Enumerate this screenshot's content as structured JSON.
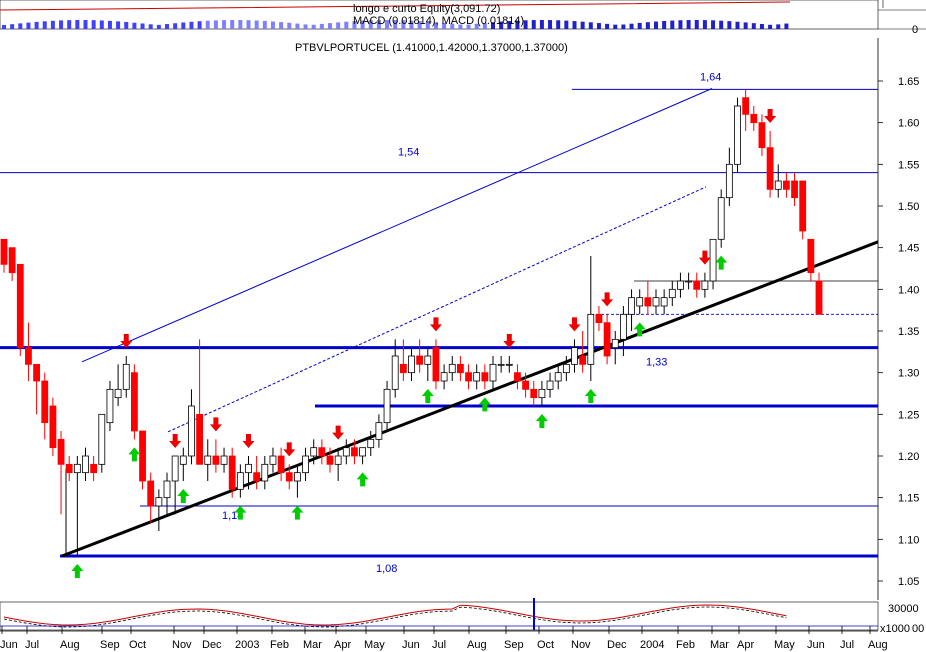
{
  "header": {
    "equity_text": "longo e curto Equity(3,091.72)",
    "macd_text": "MACD (0.01814), MACD (0.01814)",
    "macd_zero_label": "0",
    "title": "PTBVLPORTUCEL (1.41000,1.42000,1.37000,1.37000)"
  },
  "lower": {
    "label": "30000",
    "scale": "x1000",
    "zero": "00"
  },
  "colors": {
    "up": "#ffffff",
    "down": "#ff0000",
    "blue": "#0000cc",
    "trend": "#000000",
    "buy": "#00cc00",
    "sell": "#ee0000"
  },
  "chart_data": {
    "type": "candlestick",
    "title": "PTBVLPORTUCEL (1.41000,1.42000,1.37000,1.37000)",
    "ylim": [
      1.02,
      1.685
    ],
    "y_ticks": [
      "1.05",
      "1.10",
      "1.15",
      "1.20",
      "1.25",
      "1.30",
      "1.35",
      "1.40",
      "1.45",
      "1.50",
      "1.55",
      "1.60",
      "1.65"
    ],
    "x_labels": [
      "Jun",
      "Jul",
      "Aug",
      "Sep",
      "Oct",
      "Nov",
      "Dec",
      "2003",
      "Feb",
      "Mar",
      "Apr",
      "May",
      "Jun",
      "Jul",
      "Aug",
      "Sep",
      "Oct",
      "Nov",
      "Dec",
      "2004",
      "Feb",
      "Mar",
      "Apr",
      "May",
      "Jun",
      "Jul",
      "Aug"
    ],
    "levels": [
      {
        "label": "1,64",
        "value": 1.64
      },
      {
        "label": "1,54",
        "value": 1.54
      },
      {
        "label": "1,33",
        "value": 1.33
      },
      {
        "label": "1,14",
        "value": 1.14
      },
      {
        "label": "1,08",
        "value": 1.08
      }
    ],
    "extra_levels": [
      1.26,
      1.41,
      1.37
    ],
    "candles": [
      [
        1.46,
        1.46,
        1.42,
        1.43
      ],
      [
        1.45,
        1.45,
        1.41,
        1.42
      ],
      [
        1.43,
        1.43,
        1.32,
        1.33
      ],
      [
        1.33,
        1.36,
        1.29,
        1.31
      ],
      [
        1.31,
        1.31,
        1.25,
        1.29
      ],
      [
        1.29,
        1.3,
        1.22,
        1.24
      ],
      [
        1.26,
        1.27,
        1.2,
        1.21
      ],
      [
        1.22,
        1.23,
        1.13,
        1.19
      ],
      [
        1.19,
        1.2,
        1.17,
        1.18
      ],
      [
        1.18,
        1.2,
        1.08,
        1.19
      ],
      [
        1.18,
        1.21,
        1.17,
        1.2
      ],
      [
        1.19,
        1.2,
        1.17,
        1.18
      ],
      [
        1.19,
        1.25,
        1.18,
        1.25
      ],
      [
        1.24,
        1.29,
        1.23,
        1.28
      ],
      [
        1.27,
        1.31,
        1.26,
        1.28
      ],
      [
        1.28,
        1.32,
        1.27,
        1.31
      ],
      [
        1.3,
        1.31,
        1.22,
        1.23
      ],
      [
        1.23,
        1.23,
        1.16,
        1.17
      ],
      [
        1.17,
        1.18,
        1.12,
        1.14
      ],
      [
        1.14,
        1.16,
        1.11,
        1.15
      ],
      [
        1.15,
        1.18,
        1.13,
        1.17
      ],
      [
        1.17,
        1.2,
        1.13,
        1.2
      ],
      [
        1.19,
        1.21,
        1.17,
        1.2
      ],
      [
        1.2,
        1.28,
        1.19,
        1.26
      ],
      [
        1.25,
        1.34,
        1.19,
        1.19
      ],
      [
        1.19,
        1.22,
        1.17,
        1.2
      ],
      [
        1.2,
        1.22,
        1.18,
        1.19
      ],
      [
        1.19,
        1.21,
        1.18,
        1.2
      ],
      [
        1.2,
        1.21,
        1.15,
        1.16
      ],
      [
        1.16,
        1.19,
        1.15,
        1.18
      ],
      [
        1.18,
        1.2,
        1.16,
        1.19
      ],
      [
        1.18,
        1.2,
        1.16,
        1.17
      ],
      [
        1.17,
        1.2,
        1.16,
        1.19
      ],
      [
        1.19,
        1.21,
        1.18,
        1.2
      ],
      [
        1.2,
        1.21,
        1.17,
        1.18
      ],
      [
        1.18,
        1.19,
        1.16,
        1.17
      ],
      [
        1.17,
        1.19,
        1.15,
        1.18
      ],
      [
        1.18,
        1.21,
        1.17,
        1.2
      ],
      [
        1.2,
        1.22,
        1.19,
        1.21
      ],
      [
        1.21,
        1.22,
        1.19,
        1.2
      ],
      [
        1.2,
        1.21,
        1.18,
        1.19
      ],
      [
        1.19,
        1.21,
        1.17,
        1.2
      ],
      [
        1.2,
        1.22,
        1.19,
        1.21
      ],
      [
        1.21,
        1.22,
        1.19,
        1.2
      ],
      [
        1.2,
        1.21,
        1.19,
        1.21
      ],
      [
        1.21,
        1.23,
        1.2,
        1.22
      ],
      [
        1.22,
        1.25,
        1.21,
        1.24
      ],
      [
        1.24,
        1.29,
        1.23,
        1.28
      ],
      [
        1.28,
        1.34,
        1.27,
        1.32
      ],
      [
        1.31,
        1.34,
        1.29,
        1.3
      ],
      [
        1.3,
        1.33,
        1.29,
        1.32
      ],
      [
        1.32,
        1.34,
        1.3,
        1.31
      ],
      [
        1.31,
        1.33,
        1.29,
        1.32
      ],
      [
        1.33,
        1.34,
        1.28,
        1.29
      ],
      [
        1.29,
        1.31,
        1.28,
        1.3
      ],
      [
        1.3,
        1.32,
        1.29,
        1.31
      ],
      [
        1.31,
        1.32,
        1.29,
        1.3
      ],
      [
        1.3,
        1.31,
        1.28,
        1.29
      ],
      [
        1.29,
        1.31,
        1.28,
        1.3
      ],
      [
        1.3,
        1.31,
        1.28,
        1.29
      ],
      [
        1.29,
        1.32,
        1.28,
        1.31
      ],
      [
        1.31,
        1.32,
        1.3,
        1.31
      ],
      [
        1.31,
        1.32,
        1.3,
        1.31
      ],
      [
        1.3,
        1.31,
        1.28,
        1.29
      ],
      [
        1.29,
        1.3,
        1.27,
        1.28
      ],
      [
        1.28,
        1.29,
        1.26,
        1.27
      ],
      [
        1.27,
        1.29,
        1.26,
        1.28
      ],
      [
        1.28,
        1.3,
        1.27,
        1.29
      ],
      [
        1.29,
        1.31,
        1.28,
        1.3
      ],
      [
        1.3,
        1.32,
        1.29,
        1.31
      ],
      [
        1.31,
        1.34,
        1.3,
        1.33
      ],
      [
        1.32,
        1.35,
        1.3,
        1.31
      ],
      [
        1.31,
        1.44,
        1.29,
        1.37
      ],
      [
        1.37,
        1.38,
        1.35,
        1.36
      ],
      [
        1.36,
        1.37,
        1.31,
        1.32
      ],
      [
        1.33,
        1.35,
        1.31,
        1.34
      ],
      [
        1.34,
        1.38,
        1.32,
        1.37
      ],
      [
        1.37,
        1.4,
        1.35,
        1.39
      ],
      [
        1.38,
        1.4,
        1.37,
        1.39
      ],
      [
        1.39,
        1.41,
        1.37,
        1.38
      ],
      [
        1.38,
        1.4,
        1.37,
        1.39
      ],
      [
        1.38,
        1.4,
        1.37,
        1.39
      ],
      [
        1.39,
        1.41,
        1.38,
        1.4
      ],
      [
        1.4,
        1.42,
        1.39,
        1.41
      ],
      [
        1.41,
        1.42,
        1.4,
        1.41
      ],
      [
        1.41,
        1.42,
        1.39,
        1.4
      ],
      [
        1.4,
        1.42,
        1.39,
        1.41
      ],
      [
        1.41,
        1.46,
        1.4,
        1.46
      ],
      [
        1.46,
        1.52,
        1.45,
        1.51
      ],
      [
        1.51,
        1.57,
        1.5,
        1.55
      ],
      [
        1.55,
        1.63,
        1.54,
        1.62
      ],
      [
        1.63,
        1.64,
        1.59,
        1.61
      ],
      [
        1.61,
        1.62,
        1.59,
        1.6
      ],
      [
        1.6,
        1.61,
        1.56,
        1.57
      ],
      [
        1.57,
        1.59,
        1.51,
        1.52
      ],
      [
        1.52,
        1.55,
        1.51,
        1.53
      ],
      [
        1.53,
        1.54,
        1.51,
        1.52
      ],
      [
        1.53,
        1.54,
        1.5,
        1.51
      ],
      [
        1.53,
        1.53,
        1.46,
        1.47
      ],
      [
        1.46,
        1.46,
        1.41,
        1.42
      ],
      [
        1.41,
        1.42,
        1.37,
        1.37
      ]
    ],
    "buy_signals": [
      9,
      16,
      22,
      29,
      36,
      44,
      52,
      59,
      66,
      72,
      78,
      88
    ],
    "sell_signals": [
      15,
      21,
      26,
      30,
      35,
      41,
      53,
      62,
      70,
      74,
      86,
      94
    ]
  }
}
